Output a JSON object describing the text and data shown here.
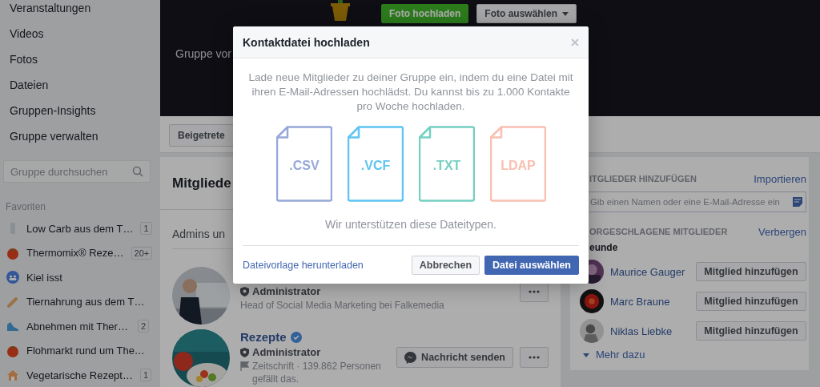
{
  "sidebar": {
    "nav": [
      "Veranstaltungen",
      "Videos",
      "Fotos",
      "Dateien",
      "Gruppen-Insights",
      "Gruppe verwalten"
    ],
    "search": {
      "placeholder": "Gruppe durchsuchen"
    },
    "favorites_heading": "Favoriten",
    "favorites": [
      {
        "kind": "bottle",
        "label": "Low Carb aus dem T…",
        "badge": "1"
      },
      {
        "kind": "tomato",
        "label": "Thermomix® Reze…",
        "badge": "20+"
      },
      {
        "kind": "group",
        "label": "Kiel isst"
      },
      {
        "kind": "bone",
        "label": "Tiernahrung aus dem T…"
      },
      {
        "kind": "shoe",
        "label": "Abnehmen mit Ther…",
        "badge": "2"
      },
      {
        "kind": "tomato",
        "label": "Flohmarkt rund um The…"
      },
      {
        "kind": "house",
        "label": "Vegetarische Rezept…",
        "badge": "1"
      }
    ]
  },
  "banner": {
    "buttons": [
      {
        "kind": "primary",
        "label": "Foto hochladen"
      },
      {
        "kind": "dropdown",
        "label": "Foto auswählen"
      }
    ],
    "text": "Gruppe vor"
  },
  "join_button": "Beigetrete",
  "members_card": {
    "title": "Mitgliede",
    "section": "Admins un",
    "members": [
      {
        "role": "Administrator",
        "description": "Head of Social Media Marketing bei Falkemedia",
        "actions": [
          {
            "kind": "more"
          }
        ]
      },
      {
        "name": "Rezepte",
        "verified": true,
        "role": "Administrator",
        "flag": true,
        "description": "Zeitschrift · 139.862 Personen gefällt das.",
        "actions": [
          {
            "kind": "message",
            "label": "Nachricht senden"
          },
          {
            "kind": "more"
          }
        ]
      }
    ]
  },
  "add_card": {
    "add_heading": "ITGLIEDER HINZUFÜGEN",
    "import_link": "Importieren",
    "add_field": {
      "placeholder": "Gib einen Namen oder eine E-Mail-Adresse ein"
    },
    "suggest_heading": "ORGESCHLAGENE MITGLIEDER",
    "hide_link": "Verbergen",
    "group_label": "eunde",
    "suggestions": [
      {
        "name": "Maurice Gauger",
        "button": "Mitglied hinzufügen"
      },
      {
        "name": "Marc Braune",
        "button": "Mitglied hinzufügen"
      },
      {
        "name": "Niklas Liebke",
        "button": "Mitglied hinzufügen"
      }
    ],
    "more_link": "Mehr dazu"
  },
  "modal": {
    "title": "Kontaktdatei hochladen",
    "intro": "Lade neue Mitglieder zu deiner Gruppe ein, indem du eine Datei mit ihren E-Mail-Adressen hochlädst. Du kannst bis zu 1.000 Kontakte pro Woche hochladen.",
    "file_types": [
      {
        "label": ".CSV",
        "color": "#95a8d8"
      },
      {
        "label": ".VCF",
        "color": "#5ec4f2"
      },
      {
        "label": ".TXT",
        "color": "#74d0c1"
      },
      {
        "label": "LDAP",
        "color": "#f9bfb0"
      }
    ],
    "caption": "Wir unterstützen diese Dateitypen.",
    "template_link": "Dateivorlage herunterladen",
    "buttons": [
      {
        "kind": "secondary",
        "label": "Abbrechen"
      },
      {
        "kind": "primary",
        "label": "Datei auswählen"
      }
    ]
  }
}
